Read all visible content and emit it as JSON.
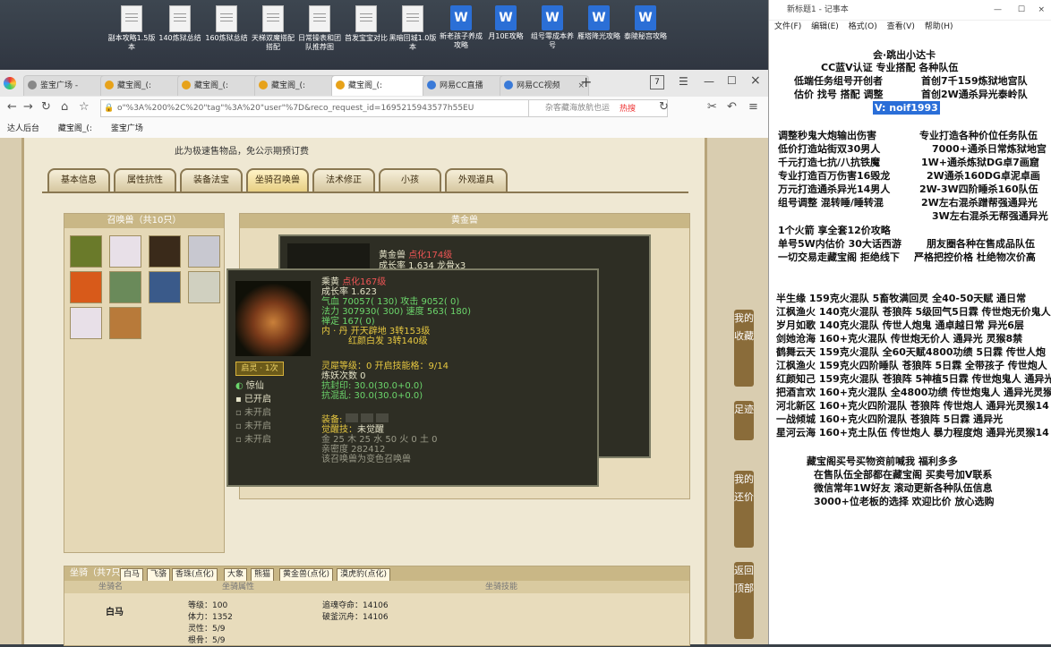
{
  "desktop": {
    "icons": [
      {
        "label": "副本攻略1.5版本",
        "type": "file"
      },
      {
        "label": "140炼狱总结",
        "type": "file"
      },
      {
        "label": "160炼狱总结",
        "type": "file"
      },
      {
        "label": "天梯双魔搭配搭配",
        "type": "file"
      },
      {
        "label": "日常操表和团队推荐图",
        "type": "file"
      },
      {
        "label": "首发宝宝对比",
        "type": "file"
      },
      {
        "label": "黑暗回城1.0版本",
        "type": "file"
      },
      {
        "label": "新老孩子养成攻略",
        "type": "word"
      },
      {
        "label": "月10E攻略",
        "type": "word"
      },
      {
        "label": "组号零成本养号",
        "type": "word"
      },
      {
        "label": "雁塔降光攻略",
        "type": "word"
      },
      {
        "label": "泰陵秘宫攻略",
        "type": "word"
      }
    ]
  },
  "browser": {
    "tabs": [
      {
        "label": "鉴宝广场 -",
        "active": false
      },
      {
        "label": "藏宝阁_(:",
        "active": false
      },
      {
        "label": "藏宝阁_(:",
        "active": false
      },
      {
        "label": "藏宝阁_(:",
        "active": false
      },
      {
        "label": "藏宝阁_(:",
        "active": true
      },
      {
        "label": "网易CC直播",
        "active": false
      },
      {
        "label": "网易CC视频",
        "active": false
      }
    ],
    "tab_count": "7",
    "url": "o\"%3A%200%2C%20\"tag\"%3A%20\"user\"%7D&reco_request_id=1695215943577h55EU",
    "search_placeholder": "杂客藏海放航也运",
    "hot_label": "热搜",
    "bookmarks": [
      "达人后台",
      "藏宝阁_(:",
      "鉴宝广场"
    ]
  },
  "game": {
    "notice": "此为极速售物品，免公示期预订费",
    "tabs": [
      "基本信息",
      "属性抗性",
      "装备法宝",
      "坐骑召唤兽",
      "法术修正",
      "小孩",
      "外观道具"
    ],
    "active_tab": "坐骑召唤兽",
    "pet_list_title": "召唤兽（共10只）",
    "golden_title": "黄金兽",
    "panel_back": {
      "name": "黄金兽",
      "point": "点化174级",
      "growth": "成长率 1.634 龙骨x3"
    },
    "panel_front": {
      "name": "乘黄",
      "point": "点化167级",
      "growth": "成长率 1.623",
      "hp_label": "气血",
      "hp": "70057",
      "hp_add": "( 130)",
      "atk_label": "攻击",
      "atk": "9052",
      "atk_add": "( 0)",
      "mp_label": "法力",
      "mp": "307930",
      "mp_add": "( 300)",
      "spd_label": "速度",
      "spd": "563",
      "spd_add": "( 180)",
      "zen_label": "禅定",
      "zen": "167",
      "zen_add": "( 0)",
      "inner": "内 · 丹 开天辟地 3转153级",
      "inner2": "红颜白发 3转140级",
      "awaken_label": "启灵 · 1次",
      "skills": [
        "惊仙",
        "已开启",
        "未开启",
        "未开启",
        "未开启"
      ],
      "spirit_label": "灵犀等级：",
      "spirit_val": "0 开启技能格：",
      "spirit_slots": "9/14",
      "lianyao": "炼妖次数 0",
      "seal": "抗封印: 30.0(30.0+0.0)",
      "chaos": "抗混乱: 30.0(30.0+0.0)",
      "equip_label": "装备:",
      "awake": "觉醒技：",
      "awake_val": "未觉醒",
      "elements": "金 25 木 25 水 50 火 0 土 0",
      "intimacy": "亲密度 282412",
      "note": "该召唤兽为变色召唤兽"
    },
    "mount": {
      "title": "坐骑（共7只）",
      "tabs": [
        "白马",
        "飞骆",
        "香珠(点化)",
        "大象",
        "熊猫",
        "黄金兽(点化)",
        "漠虎豹(点化)"
      ],
      "col_headers": [
        "坐骑名",
        "坐骑属性",
        "坐骑技能"
      ],
      "name": "白马",
      "stats": [
        "等级：100",
        "体力：1352",
        "灵性：5/9",
        "根骨：5/9"
      ],
      "skills": [
        "追魂夺命：14106",
        "破釜沉舟：14106"
      ]
    },
    "side_buttons": [
      "我的收藏",
      "足迹",
      "我的还价",
      "返回顶部"
    ]
  },
  "notepad": {
    "title": "新标题1 - 记事本",
    "menu": [
      "文件(F)",
      "编辑(E)",
      "格式(O)",
      "查看(V)",
      "帮助(H)"
    ],
    "lines": [
      "会·跳出小达卡",
      "CC蓝V认证 专业搭配 各种队伍",
      "低端任务组号开创者",
      "首创7千159炼狱地宫队",
      "估价 找号 搭配 调整",
      "首创2W通杀异光泰岭队",
      "V: noif1993",
      "调整秒鬼大炮输出伤害",
      "专业打造各种价位任务队伍",
      "低价打造站街双30男人",
      "7000+通杀日常炼狱地宫",
      "千元打造七抗/八抗铁魔",
      "1W+通杀炼狱DG卓7画窟",
      "专业打造百万伤害16毁龙",
      "2W通杀160DG卓泥卓画",
      "万元打造通杀异光14男人",
      "2W-3W四阶睡杀160队伍",
      "组号调整 混转睡/睡转混",
      "2W左右混杀蹭帮强通异光",
      "3W左右混杀无帮强通异光",
      "1个火箭 享全套12价攻略",
      "单号5W内估价 30大话西游",
      "朋友圈各种在售成品队伍",
      "一切交易走藏宝阁 拒绝线下",
      "严格把控价格 杜绝物次价高",
      "半生缘   159克火混队 5畜牧满回灵 全40-50天赋 通日常",
      "江枫渔火 140克火混队 苍狼阵 5级回气5日霖 传世炮无价鬼人",
      "岁月如歌 140克火混队 传世人炮鬼 通卓越日常 异光6层",
      "剑她沧海 160+克火混队 传世炮无价人 通异光 灵猴8禁",
      "鹤舞云天 159克火混队 全60天赋4800功绩 5日霖 传世人炮",
      "江枫渔火 159克火四阶睡队 苍狼阵 5日霖 全带孩子 传世炮人",
      "红颜知己 159克火混队 苍狼阵 5神植5日霖 传世炮鬼人 通异光",
      "把酒言欢 160+克火混队 全4800功绩 传世炮鬼人 通异光灵猴",
      "河北新区 160+克火四阶混队 苍狼阵 传世炮人 通异光灵猴14",
      "一战倾城 160+克火四阶混队 苍狼阵 5日霖 通异光",
      "星河云海 160+克土队伍 传世炮人 暴力程度炮 通异光灵猴14",
      "藏宝阁买号买物资前喊我 福利多多",
      "在售队伍全部都在藏宝阁 买卖号加V联系",
      "微信常年1W好友 滚动更新各种队伍信息",
      "3000+位老板的选择 欢迎比价 放心选购"
    ]
  }
}
